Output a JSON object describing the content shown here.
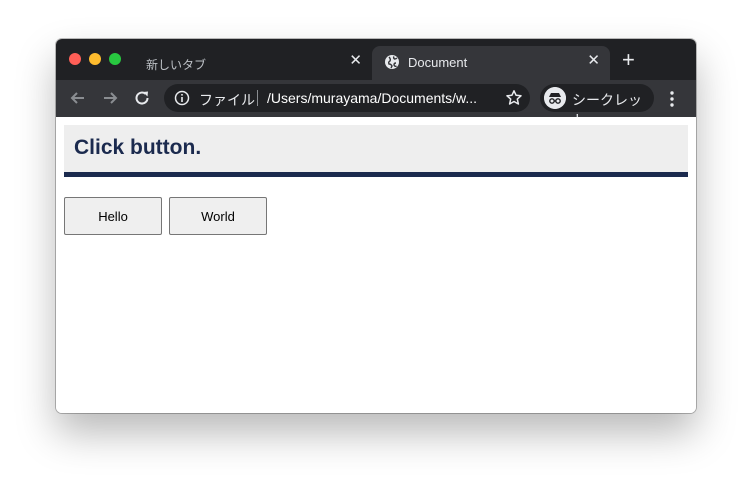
{
  "browser": {
    "tabs": [
      {
        "title": "新しいタブ",
        "active": false
      },
      {
        "title": "Document",
        "active": true
      }
    ],
    "omnibox": {
      "scheme_label": "ファイル",
      "url": "/Users/murayama/Documents/w..."
    },
    "profile": {
      "label": "シークレット"
    },
    "icons": [
      "back-arrow-icon",
      "forward-arrow-icon",
      "reload-icon",
      "info-icon",
      "star-icon",
      "incognito-icon",
      "menu-dots-icon",
      "globe-icon",
      "close-icon",
      "plus-icon"
    ]
  },
  "page": {
    "heading": "Click button.",
    "buttons": [
      {
        "label": "Hello"
      },
      {
        "label": "World"
      }
    ]
  },
  "colors": {
    "heading_text": "#1b2a4e",
    "heading_border": "#1b2a4e",
    "heading_bg": "#eeeeee"
  }
}
